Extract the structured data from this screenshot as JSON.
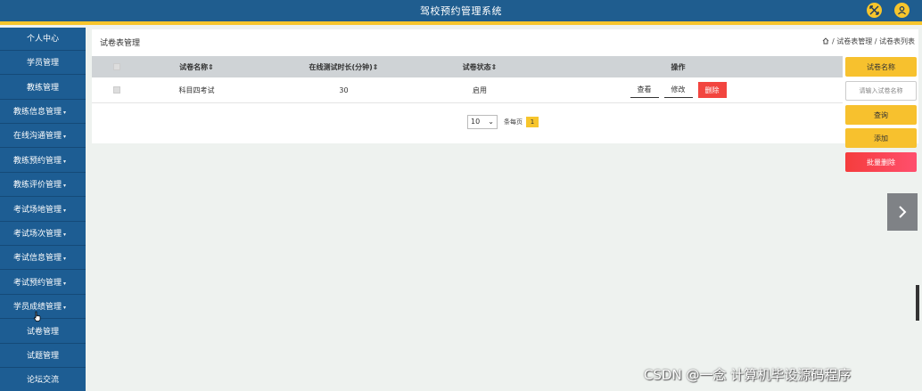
{
  "header": {
    "title": "驾校预约管理系统"
  },
  "sidebar": {
    "items": [
      {
        "label": "个人中心",
        "arrow": false
      },
      {
        "label": "学员管理",
        "arrow": false
      },
      {
        "label": "教练管理",
        "arrow": false
      },
      {
        "label": "教练信息管理",
        "arrow": true
      },
      {
        "label": "在线沟通管理",
        "arrow": true
      },
      {
        "label": "教练预约管理",
        "arrow": true
      },
      {
        "label": "教练评价管理",
        "arrow": true
      },
      {
        "label": "考试场地管理",
        "arrow": true
      },
      {
        "label": "考试场次管理",
        "arrow": true
      },
      {
        "label": "考试信息管理",
        "arrow": true
      },
      {
        "label": "考试预约管理",
        "arrow": true
      },
      {
        "label": "学员成绩管理",
        "arrow": true
      },
      {
        "label": "试卷管理",
        "arrow": false
      },
      {
        "label": "试题管理",
        "arrow": false
      },
      {
        "label": "论坛交流",
        "arrow": false
      }
    ],
    "arrow_glyph": "▾"
  },
  "page": {
    "title": "试卷表管理",
    "breadcrumb": {
      "sep1": "/",
      "level1": "试卷表管理",
      "sep2": "/",
      "level2": "试卷表列表"
    }
  },
  "table": {
    "columns": [
      "试卷名称⇕",
      "在线测试时长(分钟)⇕",
      "试卷状态⇕",
      "操作"
    ],
    "rows": [
      {
        "name": "科目四考试",
        "duration": "30",
        "status": "启用"
      }
    ],
    "actions": {
      "view": "查看",
      "edit": "修改",
      "delete": "删除"
    }
  },
  "pagination": {
    "page_size": "10",
    "page_size_chevron": "⌄",
    "page_label": "条每页",
    "current_page": "1"
  },
  "right_panel": {
    "name_label": "试卷名称",
    "name_placeholder": "请输入试卷名称",
    "search_label": "查询",
    "add_label": "添加",
    "batch_delete_label": "批量删除"
  },
  "watermark": "CSDN @一念 计算机毕设源码程序",
  "colors": {
    "header": "#1f5d8f",
    "accent": "#f7c52c",
    "danger": "#f2453f",
    "sidebar": "#1d5d93"
  }
}
